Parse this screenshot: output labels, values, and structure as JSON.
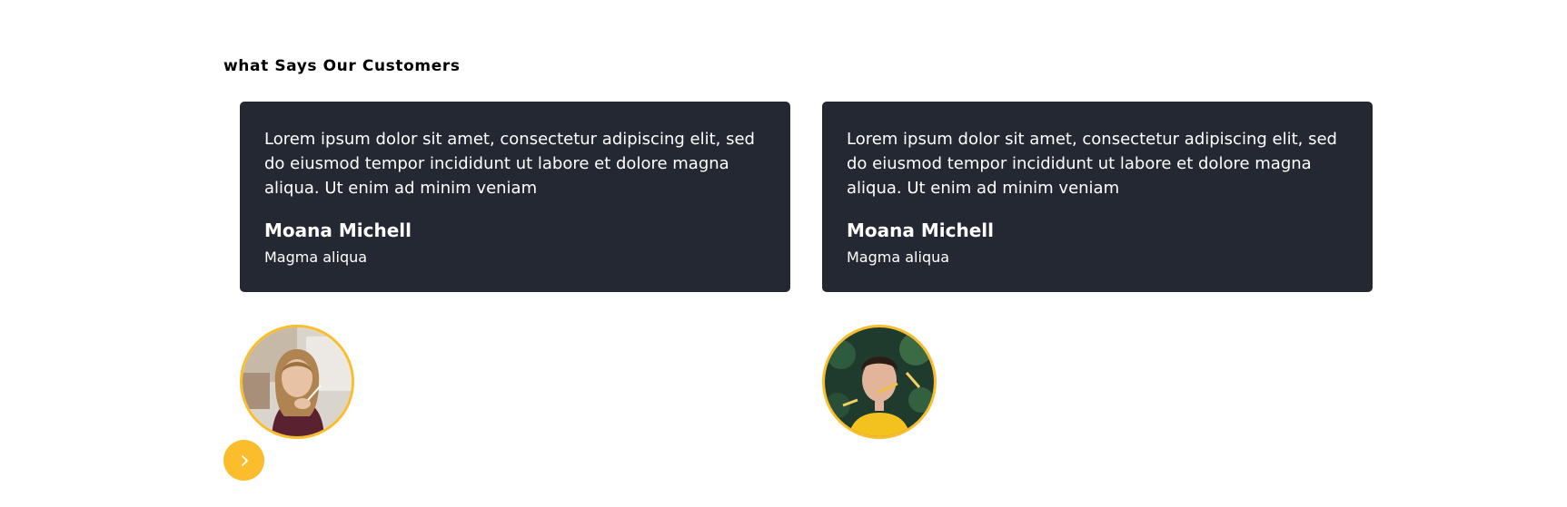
{
  "section": {
    "heading": "what Says Our Customers"
  },
  "testimonials": [
    {
      "quote": "Lorem ipsum dolor sit amet, consectetur adipiscing elit, sed do eiusmod tempor incididunt ut labore et dolore magna aliqua. Ut enim ad minim veniam",
      "name": "Moana Michell",
      "role": "Magma aliqua"
    },
    {
      "quote": "Lorem ipsum dolor sit amet, consectetur adipiscing elit, sed do eiusmod tempor incididunt ut labore et dolore magna aliqua. Ut enim ad minim veniam",
      "name": "Moana Michell",
      "role": "Magma aliqua"
    }
  ],
  "controls": {
    "next_icon": "chevron-right-icon"
  },
  "colors": {
    "card_background": "#232832",
    "accent": "#fbbd2c",
    "text_on_card": "#ffffff",
    "heading": "#000000"
  }
}
